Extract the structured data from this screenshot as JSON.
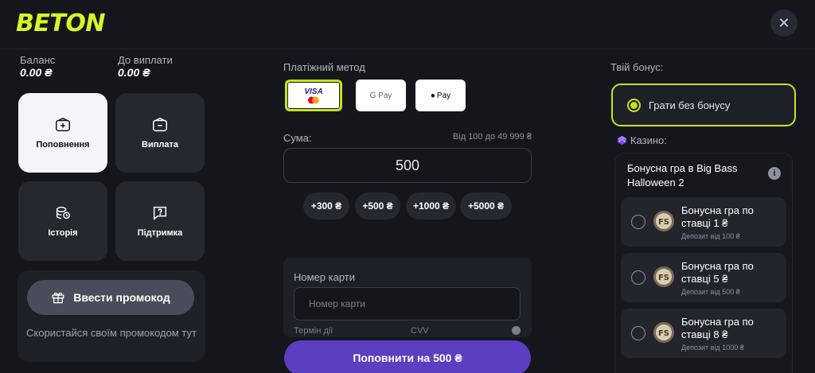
{
  "header": {
    "logo": "BETON",
    "close_label": "✕"
  },
  "balance": {
    "balance_label": "Баланс",
    "balance_value": "0.00 ₴",
    "payout_label": "До виплати",
    "payout_value": "0.00 ₴"
  },
  "menu": [
    {
      "label": "Поповнення",
      "icon": "wallet-plus-icon",
      "active": true
    },
    {
      "label": "Виплата",
      "icon": "wallet-minus-icon",
      "active": false
    },
    {
      "label": "Історія",
      "icon": "history-coins-icon",
      "active": false
    },
    {
      "label": "Підтримка",
      "icon": "support-chat-icon",
      "active": false
    }
  ],
  "promo": {
    "button_label": "Ввести промокод",
    "hint": "Скористайся своїм промокодом тут"
  },
  "payment": {
    "method_label": "Платіжний метод",
    "methods": [
      {
        "name": "visa-mastercard",
        "label": "VISA"
      },
      {
        "name": "google-pay",
        "label": "G Pay"
      },
      {
        "name": "apple-pay",
        "label": "Pay"
      }
    ],
    "amount_label": "Сума:",
    "amount_range": "Від 100 до 49 999 ₴",
    "amount_value": "500",
    "chips": [
      "+300 ₴",
      "+500 ₴",
      "+1000 ₴",
      "+5000 ₴"
    ]
  },
  "card": {
    "number_label": "Номер карти",
    "number_placeholder": "Номер карти",
    "expiry_label": "Термін дії",
    "cvv_label": "CVV"
  },
  "submit_label": "Поповнити на 500 ₴",
  "bonus": {
    "label": "Твій бонус:",
    "no_bonus": "Грати без бонусу",
    "casino_label": "Казино:",
    "casino_title": "Бонусна гра в Big Bass Halloween 2",
    "offers": [
      {
        "title": "Бонусна гра по ставці 1 ₴",
        "deposit": "Депозит від 100 ₴"
      },
      {
        "title": "Бонусна гра по ставці 5 ₴",
        "deposit": "Депозит від 500 ₴"
      },
      {
        "title": "Бонусна гра по ставці 8 ₴",
        "deposit": "Депозит від 1000 ₴"
      }
    ]
  },
  "colors": {
    "accent": "#c7e31a",
    "primary": "#5b3fc0",
    "background": "#15161c"
  }
}
